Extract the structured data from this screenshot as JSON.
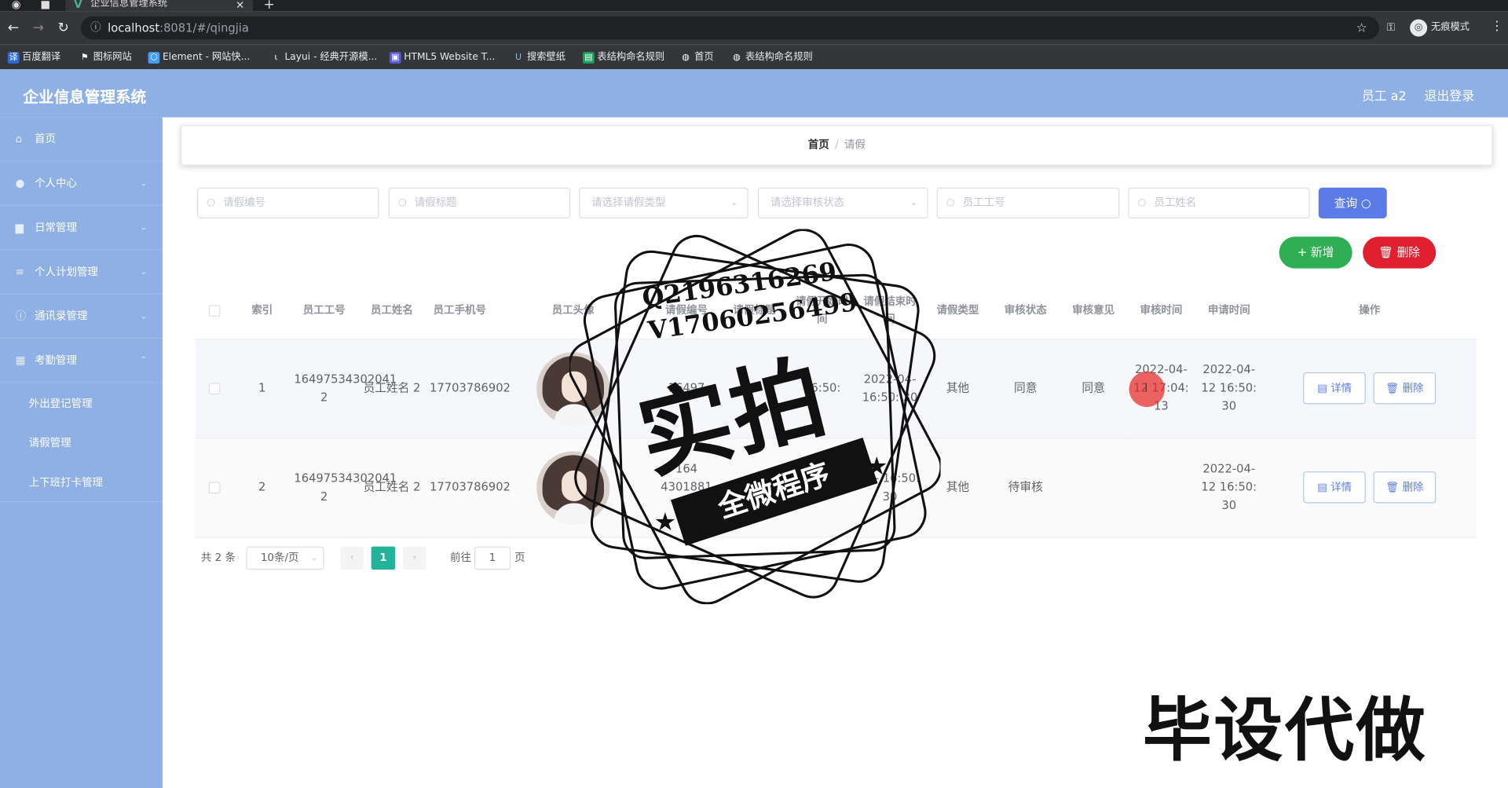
{
  "browser": {
    "tab_title": "企业信息管理系统",
    "url_host": "localhost",
    "url_path": ":8081/#/qingjia",
    "incognito_label": "无痕模式",
    "bookmarks": [
      "百度翻译",
      "图标网站",
      "Element - 网站快...",
      "Layui - 经典开源模...",
      "HTML5 Website T...",
      "搜索壁纸",
      "表结构命名规则",
      "首页",
      "表结构命名规则"
    ]
  },
  "header": {
    "title": "企业信息管理系统",
    "user": "员工 a2",
    "logout": "退出登录"
  },
  "sidebar": {
    "items": [
      "首页",
      "个人中心",
      "日常管理",
      "个人计划管理",
      "通讯录管理",
      "考勤管理"
    ],
    "subitems": [
      "外出登记管理",
      "请假管理",
      "上下班打卡管理"
    ]
  },
  "breadcrumb": {
    "home": "首页",
    "sep": "/",
    "current": "请假"
  },
  "search": {
    "leave_no_ph": "请假编号",
    "leave_title_ph": "请假标题",
    "leave_type_ph": "请选择请假类型",
    "audit_status_ph": "请选择审核状态",
    "emp_no_ph": "员工工号",
    "emp_name_ph": "员工姓名",
    "query_label": "查询"
  },
  "actions": {
    "add_label": "新增",
    "delete_label": "删除"
  },
  "table": {
    "headers": [
      "索引",
      "员工工号",
      "员工姓名",
      "员工手机号",
      "员工头像",
      "请假编号",
      "请假标题",
      "请假开始时间",
      "请假结束时间",
      "请假类型",
      "审核状态",
      "审核意见",
      "审核时间",
      "申请时间",
      "操作"
    ],
    "rows": [
      {
        "index": "1",
        "emp_no": "16497534302041 2",
        "emp_name": "员工姓名 2",
        "phone": "17703786902",
        "leave_no": "16497",
        "leave_title": "5",
        "start": "16:50:",
        "end": "2022-04- 16:50: 30",
        "type": "其他",
        "status": "同意",
        "opinion": "同意",
        "audit_time": "2022-04- 12 17:04: 13",
        "apply_time": "2022-04- 12 16:50: 30"
      },
      {
        "index": "2",
        "emp_no": "16497534302041 2",
        "emp_name": "员工姓名 2",
        "phone": "17703786902",
        "leave_no": "164 4301881 9",
        "leave_title": "请假标题",
        "start": "2022",
        "end": "22- 16:50: 30",
        "type": "其他",
        "status": "待审核",
        "opinion": "",
        "audit_time": "",
        "apply_time": "2022-04- 12 16:50: 30"
      }
    ],
    "detail_label": "详情",
    "row_delete_label": "删除"
  },
  "pager": {
    "total": "共 2 条",
    "size": "10条/页",
    "page": "1",
    "goto": "前往",
    "goto_value": "1",
    "page_suffix": "页"
  },
  "watermark": {
    "qq": "Q2196316269",
    "vx": "V17060256499",
    "big": "实拍",
    "ribbon": "全微程序"
  },
  "overlay_text": "毕设代做",
  "colors": {
    "header_bg": "#8fb0e4",
    "query_btn": "#5b7ce8",
    "add_btn": "#2fae54",
    "delete_btn": "#e0202f",
    "active_page": "#23b29a"
  }
}
